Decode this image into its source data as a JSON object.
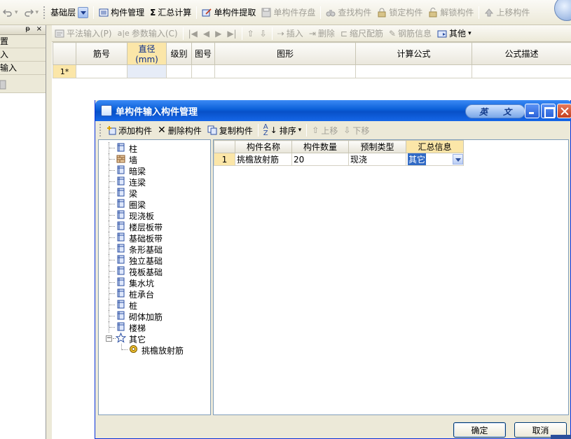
{
  "main_toolbar": {
    "floor_label": "基础层",
    "items": [
      {
        "label": "构件管理",
        "icon": "component-manage-icon"
      },
      {
        "label": "汇总计算",
        "icon": "sigma-icon"
      },
      {
        "label": "单构件提取",
        "icon": "extract-icon"
      },
      {
        "label": "单构件存盘",
        "icon": "save-disk-icon"
      },
      {
        "label": "查找构件",
        "icon": "binoculars-icon"
      },
      {
        "label": "锁定构件",
        "icon": "lock-icon"
      },
      {
        "label": "解锁构件",
        "icon": "unlock-icon"
      },
      {
        "label": "上移构件",
        "icon": "up-arrow-icon"
      }
    ]
  },
  "sub_toolbar": {
    "items": [
      {
        "label": "平法输入(P)",
        "icon": "flat-input-icon"
      },
      {
        "label": "参数输入(C)",
        "icon": "param-input-icon"
      },
      {
        "label": "插入",
        "icon": "insert-row-icon"
      },
      {
        "label": "删除",
        "icon": "delete-row-icon"
      },
      {
        "label": "缩尺配筋",
        "icon": "scale-rebar-icon"
      },
      {
        "label": "钢筋信息",
        "icon": "rebar-info-icon"
      },
      {
        "label": "其他",
        "icon": "other-icon"
      }
    ]
  },
  "dock": {
    "pin": "ᵽ",
    "close": "×",
    "rows": [
      "置",
      "入",
      "输入"
    ]
  },
  "rebar_grid": {
    "columns": [
      "筋号",
      "直径(mm)",
      "级别",
      "图号",
      "图形",
      "计算公式",
      "公式描述"
    ],
    "rows": [
      {
        "num": "1*"
      }
    ]
  },
  "dialog": {
    "title": "单构件输入构件管理",
    "ime": [
      "英",
      "文"
    ],
    "toolbar": {
      "add": "添加构件",
      "delete": "删除构件",
      "copy": "复制构件",
      "sort": "排序",
      "move_up": "上移",
      "move_down": "下移"
    },
    "tree": [
      {
        "label": "柱",
        "icon": "column-icon"
      },
      {
        "label": "墙",
        "icon": "wall-icon"
      },
      {
        "label": "暗梁",
        "icon": "hidden-beam-icon"
      },
      {
        "label": "连梁",
        "icon": "link-beam-icon"
      },
      {
        "label": "梁",
        "icon": "beam-icon"
      },
      {
        "label": "圈梁",
        "icon": "ring-beam-icon"
      },
      {
        "label": "现浇板",
        "icon": "slab-icon"
      },
      {
        "label": "楼层板带",
        "icon": "floor-strip-icon"
      },
      {
        "label": "基础板带",
        "icon": "foundation-strip-icon"
      },
      {
        "label": "条形基础",
        "icon": "strip-foundation-icon"
      },
      {
        "label": "独立基础",
        "icon": "isolated-foundation-icon"
      },
      {
        "label": "筏板基础",
        "icon": "raft-foundation-icon"
      },
      {
        "label": "集水坑",
        "icon": "sump-pit-icon"
      },
      {
        "label": "桩承台",
        "icon": "pile-cap-icon"
      },
      {
        "label": "桩",
        "icon": "pile-icon"
      },
      {
        "label": "砌体加筋",
        "icon": "masonry-rebar-icon"
      },
      {
        "label": "楼梯",
        "icon": "stairs-icon"
      },
      {
        "label": "其它",
        "icon": "star-icon",
        "expanded": true
      },
      {
        "label": "挑檐放射筋",
        "icon": "gear-icon",
        "child": true
      }
    ],
    "grid": {
      "columns": [
        "构件名称",
        "构件数量",
        "预制类型",
        "汇总信息"
      ],
      "rows": [
        {
          "num": "1",
          "name": "挑檐放射筋",
          "count": "20",
          "type": "现浇",
          "summary": "其它"
        }
      ]
    },
    "ok": "确定",
    "cancel": "取消"
  }
}
